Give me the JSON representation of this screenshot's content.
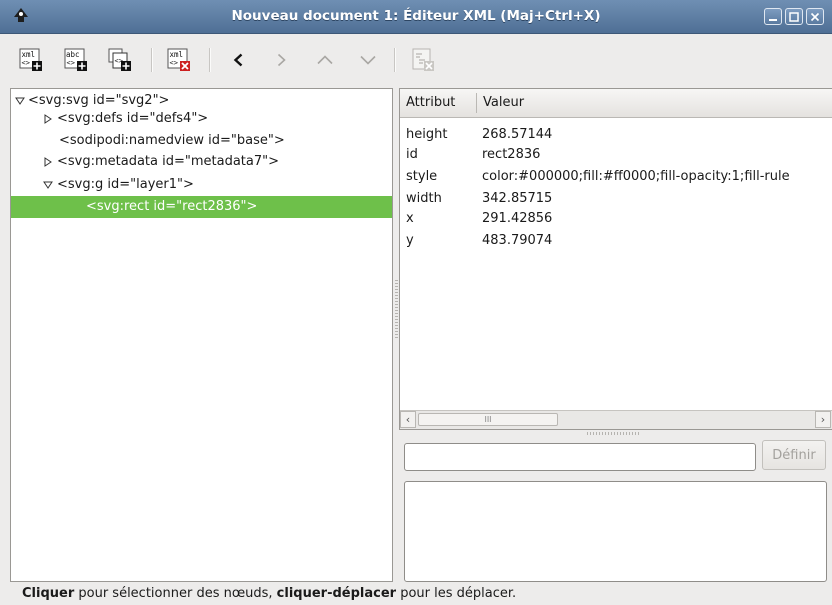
{
  "window": {
    "title": "Nouveau document 1: Éditeur XML (Maj+Ctrl+X)",
    "controls": [
      "minimize-icon",
      "maximize-icon",
      "close-icon"
    ]
  },
  "toolbar": {
    "buttons": [
      {
        "name": "new-element-node-icon",
        "text": "xml"
      },
      {
        "name": "new-text-node-icon",
        "text": "abc"
      },
      {
        "name": "duplicate-node-icon",
        "text": ""
      },
      {
        "name": "delete-node-icon",
        "text": "xml"
      },
      {
        "name": "unindent-node-icon",
        "glyph": "‹"
      },
      {
        "name": "indent-node-icon",
        "glyph": "›"
      },
      {
        "name": "raise-node-icon",
        "glyph": "^"
      },
      {
        "name": "lower-node-icon",
        "glyph": "v"
      },
      {
        "name": "delete-attribute-icon",
        "text": ""
      }
    ]
  },
  "tree": {
    "nodes": [
      {
        "label": "<svg:svg id=\"svg2\">",
        "expander": "expanded"
      },
      {
        "label": "<svg:defs id=\"defs4\">",
        "expander": "collapsed"
      },
      {
        "label": "<sodipodi:namedview id=\"base\">",
        "expander": "none"
      },
      {
        "label": "<svg:metadata id=\"metadata7\">",
        "expander": "collapsed"
      },
      {
        "label": "<svg:g id=\"layer1\">",
        "expander": "expanded"
      },
      {
        "label": "<svg:rect id=\"rect2836\">",
        "expander": "none",
        "selected": true
      }
    ]
  },
  "attributes": {
    "col_attribute": "Attribut",
    "col_value": "Valeur",
    "rows": [
      {
        "key": "height",
        "value": "268.57144"
      },
      {
        "key": "id",
        "value": "rect2836"
      },
      {
        "key": "style",
        "value": "color:#000000;fill:#ff0000;fill-opacity:1;fill-rule"
      },
      {
        "key": "width",
        "value": "342.85715"
      },
      {
        "key": "x",
        "value": "291.42856"
      },
      {
        "key": "y",
        "value": "483.79074"
      }
    ],
    "scroll_thumb": "III"
  },
  "editor": {
    "value_input": "",
    "set_button": "Définir",
    "value_text": ""
  },
  "status": {
    "b1": "Cliquer",
    "t1": " pour sélectionner des nœuds, ",
    "b2": "cliquer-déplacer",
    "t2": " pour les déplacer."
  },
  "colors": {
    "titlebar": "#5b7ba2",
    "selection": "#6ec04a",
    "delete_red": "#cc1f1f"
  }
}
